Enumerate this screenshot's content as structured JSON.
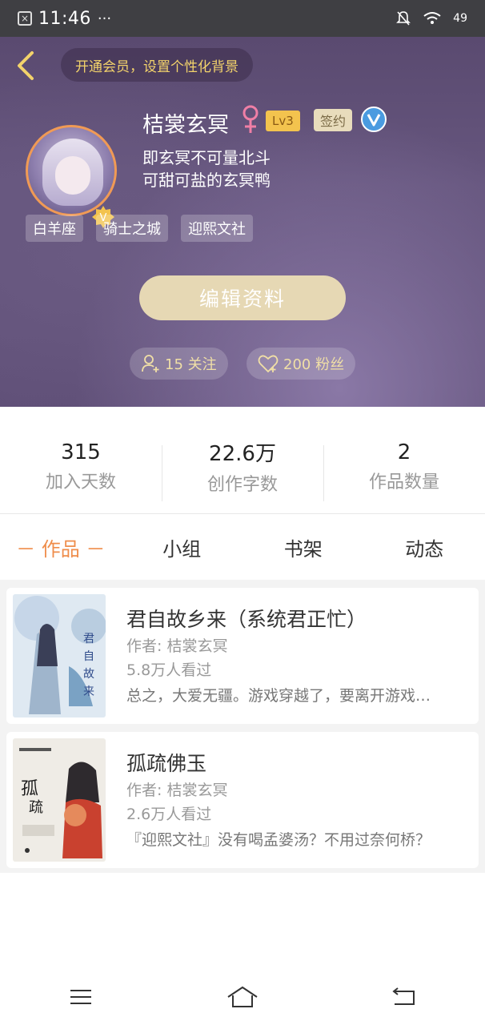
{
  "status_bar": {
    "time": "11:46",
    "dots": "···",
    "battery": "49"
  },
  "header": {
    "vip_banner": "开通会员，设置个性化背景"
  },
  "profile": {
    "name": "桔裳玄冥",
    "level": "Lv3",
    "signed_badge": "签约",
    "bio_line1": "即玄冥不可量北斗",
    "bio_line2": "可甜可盐的玄冥鸭",
    "tags": [
      "白羊座",
      "骑士之城",
      "迎熙文社"
    ],
    "edit_button": "编辑资料",
    "following": "15 关注",
    "followers": "200 粉丝"
  },
  "stats": [
    {
      "value": "315",
      "label": "加入天数"
    },
    {
      "value": "22.6万",
      "label": "创作字数"
    },
    {
      "value": "2",
      "label": "作品数量"
    }
  ],
  "tabs": [
    "－ 作品 －",
    "小组",
    "书架",
    "动态"
  ],
  "works": [
    {
      "title": "君自故乡来（系统君正忙）",
      "author": "作者: 桔裳玄冥",
      "views": "5.8万人看过",
      "desc": "总之，大爱无疆。游戏穿越了，要离开游戏…"
    },
    {
      "title": "孤疏佛玉",
      "author": "作者: 桔裳玄冥",
      "views": "2.6万人看过",
      "desc": "『迎熙文社』没有喝孟婆汤？不用过奈何桥？"
    }
  ],
  "colors": {
    "accent": "#ef8d4b",
    "banner_text": "#f3d36b",
    "edit_button": "#e6d8b4"
  }
}
